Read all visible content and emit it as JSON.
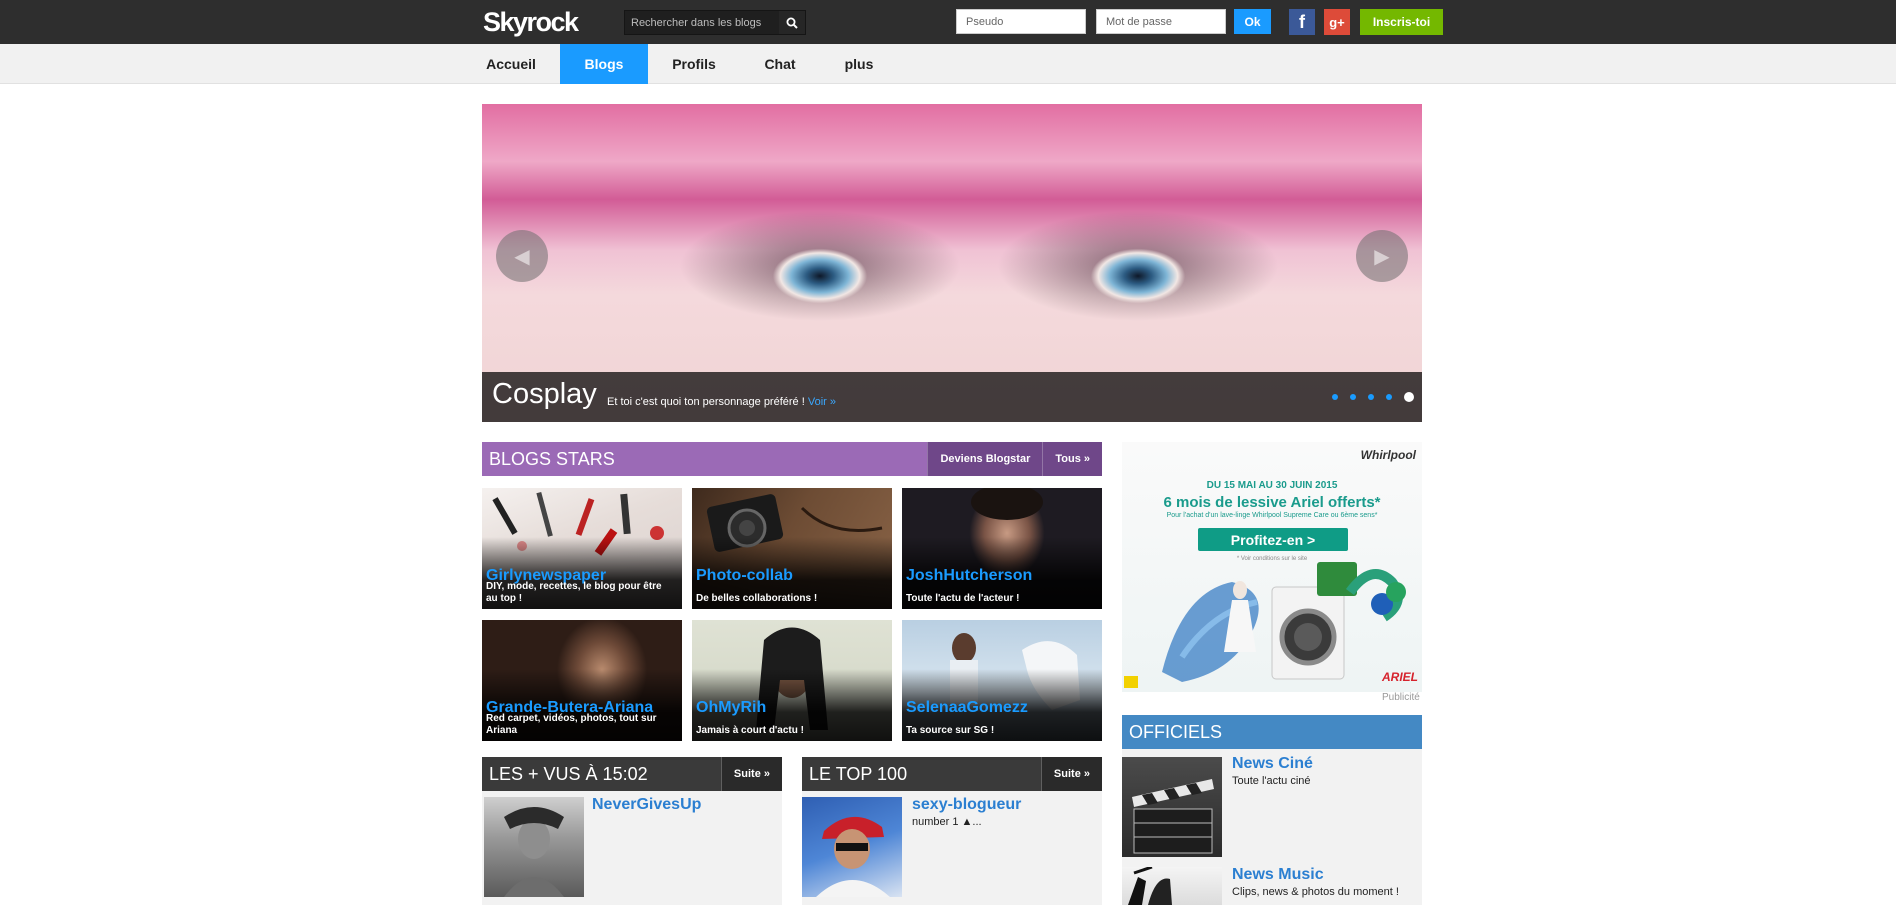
{
  "colors": {
    "accent": "#1a9bff",
    "topbar": "#2e2e2e",
    "signup": "#74b800",
    "blog_stars": "#9b6ab6",
    "officiels": "#4489c4"
  },
  "header": {
    "logo": "Skyrock",
    "search_placeholder": "Rechercher dans les blogs",
    "pseudo_placeholder": "Pseudo",
    "password_placeholder": "Mot de passe",
    "ok_label": "Ok",
    "facebook_glyph": "f",
    "google_glyph": "g+",
    "signup_label": "Inscris-toi"
  },
  "nav": {
    "items": [
      {
        "label": "Accueil"
      },
      {
        "label": "Blogs"
      },
      {
        "label": "Profils"
      },
      {
        "label": "Chat"
      },
      {
        "label": "plus"
      }
    ],
    "active": "Blogs"
  },
  "slider": {
    "title": "Cosplay",
    "text": "Et toi c'est quoi ton personnage préféré !",
    "link": "Voir »",
    "prev_glyph": "◀",
    "next_glyph": "▶",
    "dot_count": 5,
    "active_dot": 5
  },
  "blog_stars": {
    "title": "BLOGS STARS",
    "btn_become": "Deviens Blogstar",
    "btn_all": "Tous »",
    "cards": [
      {
        "name": "Girlynewspaper",
        "desc": "DIY, mode, recettes, le blog pour être au top !"
      },
      {
        "name": "Photo-collab",
        "desc": "De belles collaborations !"
      },
      {
        "name": "JoshHutcherson",
        "desc": "Toute l'actu de l'acteur !"
      },
      {
        "name": "Grande-Butera-Ariana",
        "desc": "Red carpet, vidéos, photos, tout sur Ariana"
      },
      {
        "name": "OhMyRih",
        "desc": "Jamais à court d'actu !"
      },
      {
        "name": "SelenaaGomezz",
        "desc": "Ta source sur SG !"
      }
    ]
  },
  "most_viewed": {
    "title": "LES + VUS À 15:02",
    "btn": "Suite »",
    "items": [
      {
        "name": "NeverGivesUp",
        "desc": ""
      }
    ]
  },
  "top100": {
    "title": "LE TOP 100",
    "btn": "Suite »",
    "items": [
      {
        "name": "sexy-blogueur",
        "desc": "number 1 ▲..."
      }
    ]
  },
  "ad": {
    "brand": "Whirlpool",
    "date": "DU 15 MAI AU 30 JUIN 2015",
    "headline": "6 mois de lessive Ariel offerts*",
    "sub": "Pour l'achat d'un lave-linge Whirlpool Supreme Care ou 6ème sens*",
    "cta": "Profitez-en  >",
    "note": "* Voir conditions sur le site",
    "brand2": "ARIEL",
    "label": "Publicité"
  },
  "officiels": {
    "title": "OFFICIELS",
    "items": [
      {
        "name": "News Ciné",
        "desc": "Toute l'actu ciné"
      },
      {
        "name": "News Music",
        "desc": "Clips, news & photos du moment !"
      }
    ]
  }
}
